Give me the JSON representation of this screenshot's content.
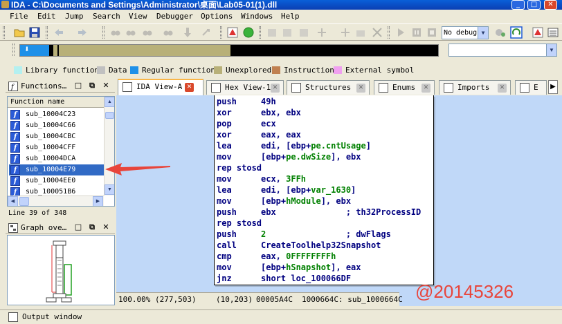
{
  "window": {
    "title": "IDA - C:\\Documents and Settings\\Administrator\\桌面\\Lab05-01(1).dll"
  },
  "menu": [
    "File",
    "Edit",
    "Jump",
    "Search",
    "View",
    "Debugger",
    "Options",
    "Windows",
    "Help"
  ],
  "toolbar": {
    "debugger_select": "No debug"
  },
  "legend": [
    {
      "label": "Library function",
      "color": "#b4f0f0"
    },
    {
      "label": "Data",
      "color": "#c0c0c0"
    },
    {
      "label": "Regular function",
      "color": "#1e90e8"
    },
    {
      "label": "Unexplored",
      "color": "#b8b078"
    },
    {
      "label": "Instruction",
      "color": "#c08050"
    },
    {
      "label": "External symbol",
      "color": "#f0a0f0"
    }
  ],
  "functions_pane": {
    "title": "Functions…",
    "column_header": "Function name",
    "items": [
      "sub_10004C23",
      "sub_10004C66",
      "sub_10004CBC",
      "sub_10004CFF",
      "sub_10004DCA",
      "sub_10004E79",
      "sub_10004EE0",
      "sub_100051B6"
    ],
    "selected_index": 5,
    "status": "Line 39 of 348"
  },
  "graph_pane": {
    "title": "Graph ove…"
  },
  "tabs": [
    {
      "label": "IDA View-A",
      "active": true
    },
    {
      "label": "Hex View-1",
      "active": false
    },
    {
      "label": "Structures",
      "active": false
    },
    {
      "label": "Enums",
      "active": false
    },
    {
      "label": "Imports",
      "active": false
    },
    {
      "label": "E",
      "active": false
    }
  ],
  "code": [
    {
      "mn": "push",
      "parts": [
        [
          "n",
          "49h"
        ]
      ]
    },
    {
      "mn": "xor",
      "parts": [
        [
          "n",
          "ebx, ebx"
        ]
      ]
    },
    {
      "mn": "pop",
      "parts": [
        [
          "n",
          "ecx"
        ]
      ]
    },
    {
      "mn": "xor",
      "parts": [
        [
          "n",
          "eax, eax"
        ]
      ]
    },
    {
      "mn": "lea",
      "parts": [
        [
          "n",
          "edi, [ebp+"
        ],
        [
          "g",
          "pe.cntUsage"
        ],
        [
          "n",
          "]"
        ]
      ]
    },
    {
      "mn": "mov",
      "parts": [
        [
          "n",
          "[ebp+"
        ],
        [
          "g",
          "pe.dwSize"
        ],
        [
          "n",
          "], ebx"
        ]
      ]
    },
    {
      "mn": "rep stosd",
      "parts": []
    },
    {
      "mn": "mov",
      "parts": [
        [
          "n",
          "ecx, "
        ],
        [
          "g",
          "3FFh"
        ]
      ]
    },
    {
      "mn": "lea",
      "parts": [
        [
          "n",
          "edi, [ebp+"
        ],
        [
          "g",
          "var_1630"
        ],
        [
          "n",
          "]"
        ]
      ]
    },
    {
      "mn": "mov",
      "parts": [
        [
          "n",
          "[ebp+"
        ],
        [
          "g",
          "hModule"
        ],
        [
          "n",
          "], ebx"
        ]
      ]
    },
    {
      "mn": "push",
      "parts": [
        [
          "n",
          "ebx              ; th32ProcessID"
        ]
      ]
    },
    {
      "mn": "rep stosd",
      "parts": []
    },
    {
      "mn": "push",
      "parts": [
        [
          "g",
          "2"
        ],
        [
          "n",
          "                ; dwFlags"
        ]
      ]
    },
    {
      "mn": "call",
      "parts": [
        [
          "n",
          "CreateToolhelp32Snapshot"
        ]
      ]
    },
    {
      "mn": "cmp",
      "parts": [
        [
          "n",
          "eax, "
        ],
        [
          "g",
          "0FFFFFFFFh"
        ]
      ]
    },
    {
      "mn": "mov",
      "parts": [
        [
          "n",
          "[ebp+"
        ],
        [
          "g",
          "hSnapshot"
        ],
        [
          "n",
          "], eax"
        ]
      ]
    },
    {
      "mn": "jnz",
      "parts": [
        [
          "n",
          "short loc_100066DF"
        ]
      ]
    }
  ],
  "ida_status": {
    "zoom": "100.00% (277,503)",
    "pos": "(10,203)",
    "offset": "00005A4C",
    "location": "1000664C: sub_1000664C"
  },
  "watermark": "@20145326",
  "output_pane": {
    "title": "Output window"
  }
}
